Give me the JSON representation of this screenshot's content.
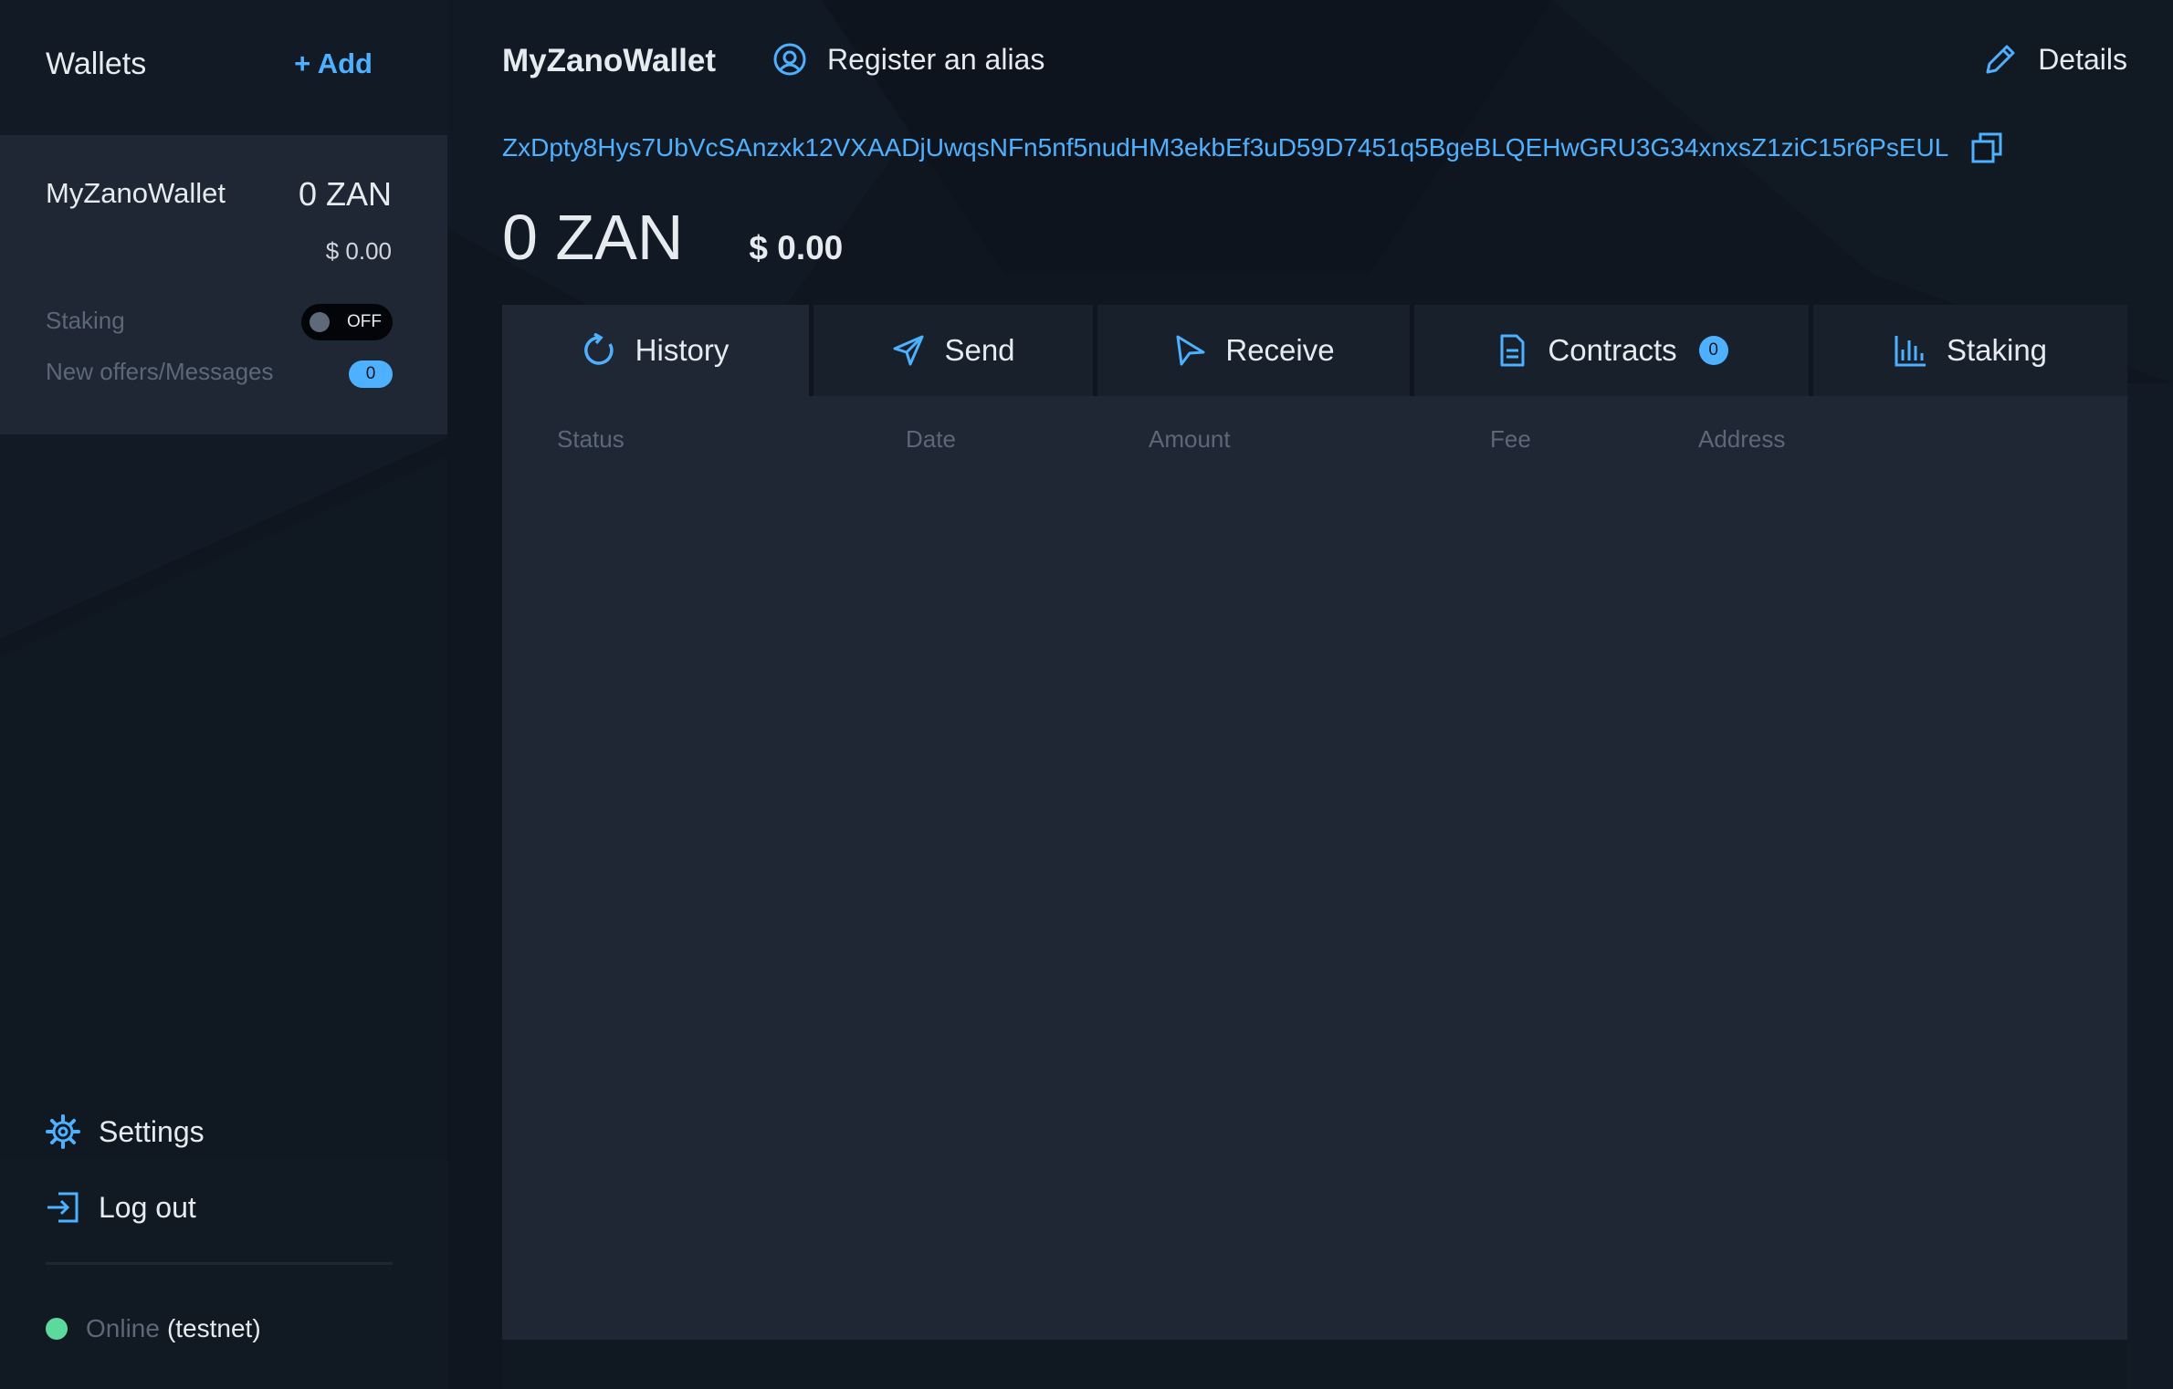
{
  "sidebar": {
    "title": "Wallets",
    "add_label": "+ Add",
    "wallet": {
      "name": "MyZanoWallet",
      "balance": "0 ZAN",
      "usd": "$ 0.00",
      "staking_label": "Staking",
      "staking_toggle": "OFF",
      "offers_label": "New offers/Messages",
      "offers_count": "0"
    },
    "settings_label": "Settings",
    "logout_label": "Log out",
    "status_online": "Online",
    "status_network": "(testnet)"
  },
  "header": {
    "wallet_name": "MyZanoWallet",
    "register_alias": "Register an alias",
    "details": "Details"
  },
  "address": "ZxDpty8Hys7UbVcSAnzxk12VXAADjUwqsNFn5nf5nudHM3ekbEf3uD59D7451q5BgeBLQEHwGRU3G34xnxsZ1ziC15r6PsEUL",
  "balance": {
    "amount": "0 ZAN",
    "usd": "$ 0.00"
  },
  "tabs": [
    {
      "label": "History",
      "icon": "history-icon"
    },
    {
      "label": "Send",
      "icon": "send-icon"
    },
    {
      "label": "Receive",
      "icon": "receive-icon"
    },
    {
      "label": "Contracts",
      "icon": "contracts-icon",
      "badge": "0"
    },
    {
      "label": "Staking",
      "icon": "staking-icon"
    }
  ],
  "history": {
    "columns": [
      "Status",
      "Date",
      "Amount",
      "Fee",
      "Address"
    ]
  },
  "colors": {
    "accent": "#4db1ff",
    "background": "#0f1620",
    "panel": "#1e2733",
    "online": "#5cda9d"
  }
}
